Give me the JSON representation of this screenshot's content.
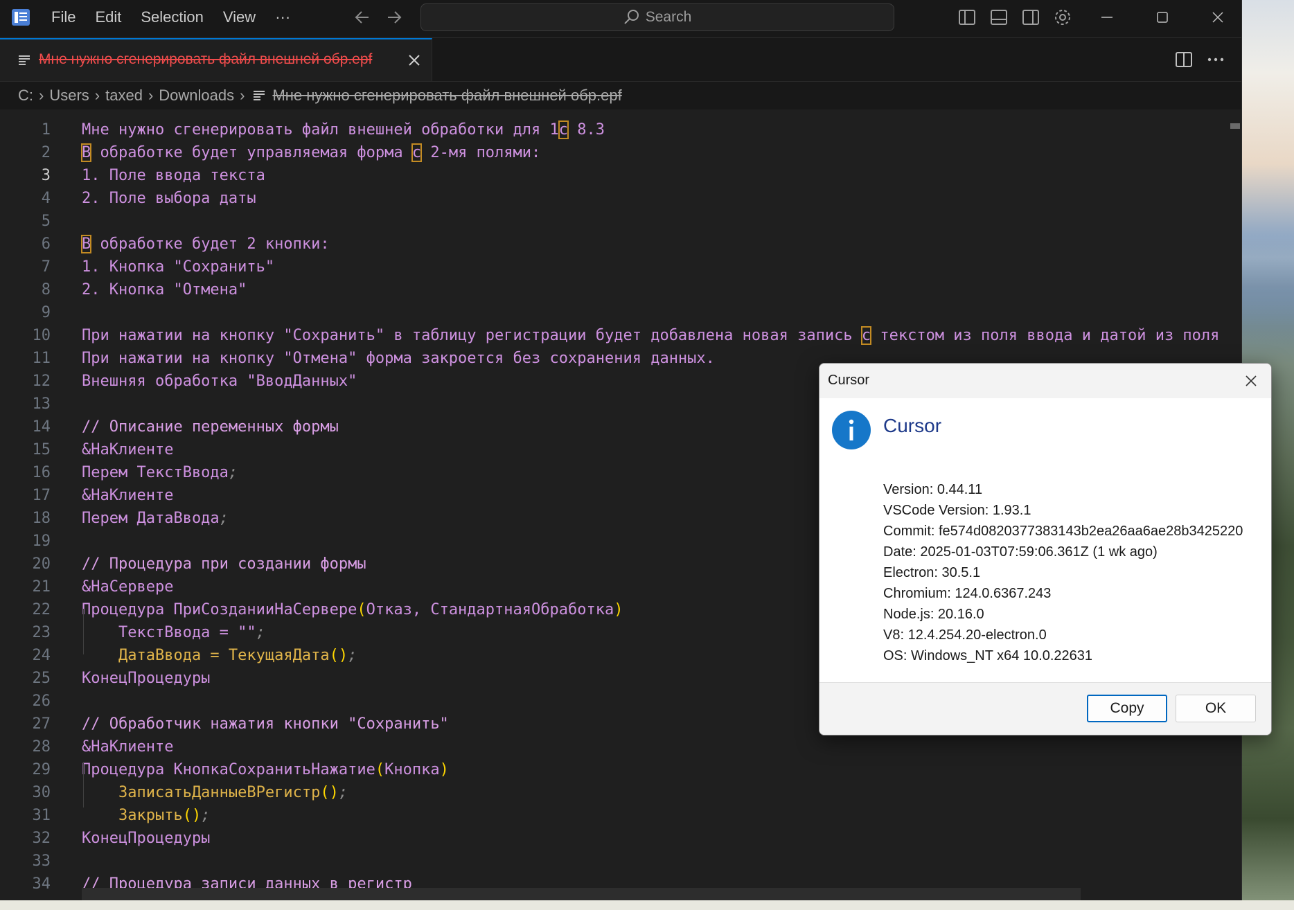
{
  "menu": [
    "File",
    "Edit",
    "Selection",
    "View",
    "···"
  ],
  "search": {
    "label": "Search"
  },
  "tab": {
    "label": "Мне нужно сгенерировать файл внешней обр.epf"
  },
  "breadcrumb": [
    "C:",
    "Users",
    "taxed",
    "Downloads",
    "Мне нужно сгенерировать файл внешней обр.epf"
  ],
  "editor": {
    "active_line": 3,
    "line_numbers": [
      "1",
      "2",
      "3",
      "4",
      "5",
      "6",
      "7",
      "8",
      "9",
      "10",
      "11",
      "12",
      "13",
      "14",
      "15",
      "16",
      "17",
      "18",
      "19",
      "20",
      "21",
      "22",
      "23",
      "24",
      "25",
      "26",
      "27",
      "28",
      "29",
      "30",
      "31",
      "32",
      "33",
      "34"
    ],
    "lines": [
      "Мне нужно сгенерировать файл внешней обработки для 1с 8.3",
      "В обработке будет управляемая форма с 2-мя полями:",
      "1. Поле ввода текста",
      "2. Поле выбора даты",
      "",
      "В обработке будет 2 кнопки:",
      "1. Кнопка \"Сохранить\"",
      "2. Кнопка \"Отмена\"",
      "",
      "При нажатии на кнопку \"Сохранить\" в таблицу регистрации будет добавлена новая запись с текстом из поля ввода и датой из поля",
      "При нажатии на кнопку \"Отмена\" форма закроется без сохранения данных.",
      "Внешняя обработка \"ВводДанных\"",
      "",
      "// Описание переменных формы",
      "&НаКлиенте",
      "Перем ТекстВвода;",
      "&НаКлиенте",
      "Перем ДатаВвода;",
      "",
      "// Процедура при создании формы",
      "&НаСервере",
      "Процедура ПриСозданииНаСервере(Отказ, СтандартнаяОбработка)",
      "    ТекстВвода = \"\";",
      "    ДатаВвода = ТекущаяДата();",
      "КонецПроцедуры",
      "",
      "// Обработчик нажатия кнопки \"Сохранить\"",
      "&НаКлиенте",
      "Процедура КнопкаСохранитьНажатие(Кнопка)",
      "    ЗаписатьДанныеВРегистр();",
      "    Закрыть();",
      "КонецПроцедуры",
      "",
      "// Процедура записи данных в регистр"
    ]
  },
  "dialog": {
    "title": "Cursor",
    "heading": "Cursor",
    "details": [
      "Version: 0.44.11",
      "VSCode Version: 1.93.1",
      "Commit: fe574d0820377383143b2ea26aa6ae28b3425220",
      "Date: 2025-01-03T07:59:06.361Z (1 wk ago)",
      "Electron: 30.5.1",
      "Chromium: 124.0.6367.243",
      "Node.js: 20.16.0",
      "V8: 12.4.254.20-electron.0",
      "OS: Windows_NT x64 10.0.22631"
    ],
    "copy_label": "Copy",
    "ok_label": "OK"
  },
  "colors": {
    "accent": "#0078d4",
    "modified_tab": "#f14c4c",
    "code_text": "#ce91e0",
    "match_highlight": "#c38b23"
  },
  "icons": [
    "app-logo-icon",
    "arrow-left-icon",
    "arrow-right-icon",
    "search-icon",
    "layout-sidebar-left-icon",
    "layout-panel-icon",
    "layout-sidebar-right-icon",
    "settings-gear-icon",
    "minimize-icon",
    "maximize-icon",
    "close-icon",
    "split-editor-icon",
    "more-icon",
    "file-text-icon",
    "info-icon"
  ]
}
